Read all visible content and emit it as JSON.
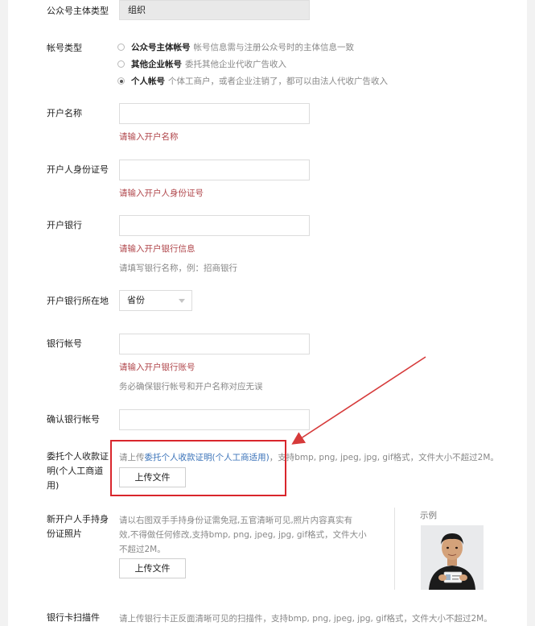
{
  "entity_type": {
    "label": "公众号主体类型",
    "value": "组织"
  },
  "account_type": {
    "label": "帐号类型",
    "options": [
      {
        "name": "公众号主体帐号",
        "desc": "帐号信息需与注册公众号时的主体信息一致",
        "selected": false
      },
      {
        "name": "其他企业帐号",
        "desc": "委托其他企业代收广告收入",
        "selected": false
      },
      {
        "name": "个人帐号",
        "desc": "个体工商户，或者企业注销了，都可以由法人代收广告收入",
        "selected": true
      }
    ]
  },
  "account_name": {
    "label": "开户名称",
    "value": "",
    "error": "请输入开户名称"
  },
  "id_number": {
    "label": "开户人身份证号",
    "value": "",
    "error": "请输入开户人身份证号"
  },
  "bank": {
    "label": "开户银行",
    "value": "",
    "error": "请输入开户银行信息",
    "hint": "请填写银行名称，例：招商银行"
  },
  "bank_location": {
    "label": "开户银行所在地",
    "selected": "省份"
  },
  "bank_account": {
    "label": "银行帐号",
    "value": "",
    "error": "请输入开户银行账号",
    "hint": "务必确保银行帐号和开户名称对应无误"
  },
  "confirm_account": {
    "label": "确认银行帐号",
    "value": ""
  },
  "authorization": {
    "label_line1": "委托个人收款证",
    "label_line2": "明(个人工商道",
    "label_line3": "用)",
    "desc_prefix": "请上传",
    "desc_link": "委托个人收款证明(个人工商适用)",
    "desc_suffix": "，支持bmp, png, jpeg, jpg, gif格式，文件大小不超过2M。",
    "upload_label": "上传文件"
  },
  "id_photo": {
    "label_line1": "新开户人手持身",
    "label_line2": "份证照片",
    "desc_line1": "请以右图双手手持身份证需免冠,五官清晰可见,照片内容真实有",
    "desc_line2": "效,不得做任何修改,支持bmp, png, jpeg, jpg, gif格式，文件大小",
    "desc_line3": "不超过2M。",
    "upload_label": "上传文件",
    "example_label": "示例"
  },
  "bank_card_scan": {
    "label": "银行卡扫描件",
    "desc": "请上传银行卡正反面清晰可见的扫描件，支持bmp, png, jpeg, jpg, gif格式，文件大小不超过2M。"
  },
  "colors": {
    "error": "#b0464b",
    "link": "#3b73b9",
    "highlight": "#d9262c",
    "arrow": "#d63a3a"
  }
}
